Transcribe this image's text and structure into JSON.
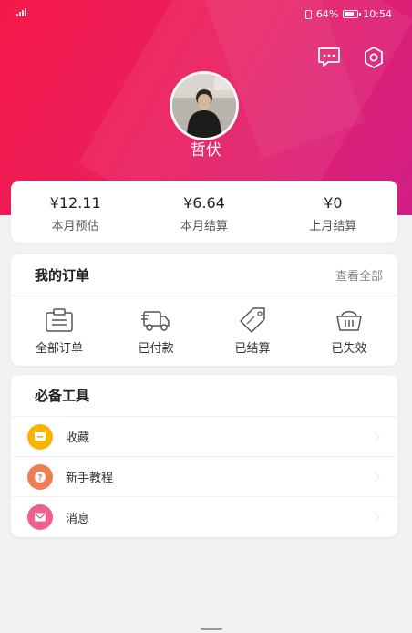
{
  "status_bar": {
    "left": "\"…ıl",
    "battery": "64%",
    "time": "10:54"
  },
  "header": {
    "username": "哲伏"
  },
  "earnings": [
    {
      "value": "¥12.11",
      "label": "本月预估"
    },
    {
      "value": "¥6.64",
      "label": "本月结算"
    },
    {
      "value": "¥0",
      "label": "上月结算"
    }
  ],
  "orders": {
    "title": "我的订单",
    "view_all": "查看全部",
    "items": [
      {
        "label": "全部订单",
        "icon": "clipboard-icon"
      },
      {
        "label": "已付款",
        "icon": "delivery-truck-icon"
      },
      {
        "label": "已结算",
        "icon": "sale-tag-icon"
      },
      {
        "label": "已失效",
        "icon": "basket-icon"
      }
    ]
  },
  "tools": {
    "title": "必备工具",
    "items": [
      {
        "label": "收藏",
        "icon": "favorites-icon",
        "color": "#f7b500"
      },
      {
        "label": "新手教程",
        "icon": "tutorial-icon",
        "color": "#ef7d52"
      },
      {
        "label": "消息",
        "icon": "message-icon",
        "color": "#ee6090"
      }
    ]
  },
  "colors": {
    "header_start": "#f5194a",
    "header_end": "#d21f86"
  }
}
